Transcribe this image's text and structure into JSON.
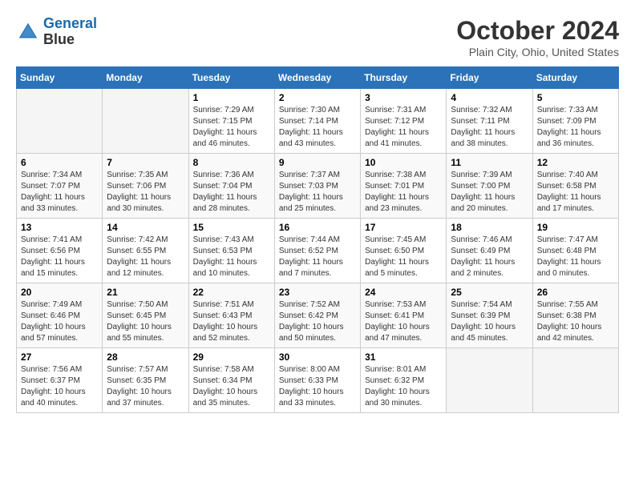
{
  "logo": {
    "line1": "General",
    "line2": "Blue"
  },
  "header": {
    "month": "October 2024",
    "location": "Plain City, Ohio, United States"
  },
  "weekdays": [
    "Sunday",
    "Monday",
    "Tuesday",
    "Wednesday",
    "Thursday",
    "Friday",
    "Saturday"
  ],
  "weeks": [
    [
      {
        "day": "",
        "sunrise": "",
        "sunset": "",
        "daylight": ""
      },
      {
        "day": "",
        "sunrise": "",
        "sunset": "",
        "daylight": ""
      },
      {
        "day": "1",
        "sunrise": "Sunrise: 7:29 AM",
        "sunset": "Sunset: 7:15 PM",
        "daylight": "Daylight: 11 hours and 46 minutes."
      },
      {
        "day": "2",
        "sunrise": "Sunrise: 7:30 AM",
        "sunset": "Sunset: 7:14 PM",
        "daylight": "Daylight: 11 hours and 43 minutes."
      },
      {
        "day": "3",
        "sunrise": "Sunrise: 7:31 AM",
        "sunset": "Sunset: 7:12 PM",
        "daylight": "Daylight: 11 hours and 41 minutes."
      },
      {
        "day": "4",
        "sunrise": "Sunrise: 7:32 AM",
        "sunset": "Sunset: 7:11 PM",
        "daylight": "Daylight: 11 hours and 38 minutes."
      },
      {
        "day": "5",
        "sunrise": "Sunrise: 7:33 AM",
        "sunset": "Sunset: 7:09 PM",
        "daylight": "Daylight: 11 hours and 36 minutes."
      }
    ],
    [
      {
        "day": "6",
        "sunrise": "Sunrise: 7:34 AM",
        "sunset": "Sunset: 7:07 PM",
        "daylight": "Daylight: 11 hours and 33 minutes."
      },
      {
        "day": "7",
        "sunrise": "Sunrise: 7:35 AM",
        "sunset": "Sunset: 7:06 PM",
        "daylight": "Daylight: 11 hours and 30 minutes."
      },
      {
        "day": "8",
        "sunrise": "Sunrise: 7:36 AM",
        "sunset": "Sunset: 7:04 PM",
        "daylight": "Daylight: 11 hours and 28 minutes."
      },
      {
        "day": "9",
        "sunrise": "Sunrise: 7:37 AM",
        "sunset": "Sunset: 7:03 PM",
        "daylight": "Daylight: 11 hours and 25 minutes."
      },
      {
        "day": "10",
        "sunrise": "Sunrise: 7:38 AM",
        "sunset": "Sunset: 7:01 PM",
        "daylight": "Daylight: 11 hours and 23 minutes."
      },
      {
        "day": "11",
        "sunrise": "Sunrise: 7:39 AM",
        "sunset": "Sunset: 7:00 PM",
        "daylight": "Daylight: 11 hours and 20 minutes."
      },
      {
        "day": "12",
        "sunrise": "Sunrise: 7:40 AM",
        "sunset": "Sunset: 6:58 PM",
        "daylight": "Daylight: 11 hours and 17 minutes."
      }
    ],
    [
      {
        "day": "13",
        "sunrise": "Sunrise: 7:41 AM",
        "sunset": "Sunset: 6:56 PM",
        "daylight": "Daylight: 11 hours and 15 minutes."
      },
      {
        "day": "14",
        "sunrise": "Sunrise: 7:42 AM",
        "sunset": "Sunset: 6:55 PM",
        "daylight": "Daylight: 11 hours and 12 minutes."
      },
      {
        "day": "15",
        "sunrise": "Sunrise: 7:43 AM",
        "sunset": "Sunset: 6:53 PM",
        "daylight": "Daylight: 11 hours and 10 minutes."
      },
      {
        "day": "16",
        "sunrise": "Sunrise: 7:44 AM",
        "sunset": "Sunset: 6:52 PM",
        "daylight": "Daylight: 11 hours and 7 minutes."
      },
      {
        "day": "17",
        "sunrise": "Sunrise: 7:45 AM",
        "sunset": "Sunset: 6:50 PM",
        "daylight": "Daylight: 11 hours and 5 minutes."
      },
      {
        "day": "18",
        "sunrise": "Sunrise: 7:46 AM",
        "sunset": "Sunset: 6:49 PM",
        "daylight": "Daylight: 11 hours and 2 minutes."
      },
      {
        "day": "19",
        "sunrise": "Sunrise: 7:47 AM",
        "sunset": "Sunset: 6:48 PM",
        "daylight": "Daylight: 11 hours and 0 minutes."
      }
    ],
    [
      {
        "day": "20",
        "sunrise": "Sunrise: 7:49 AM",
        "sunset": "Sunset: 6:46 PM",
        "daylight": "Daylight: 10 hours and 57 minutes."
      },
      {
        "day": "21",
        "sunrise": "Sunrise: 7:50 AM",
        "sunset": "Sunset: 6:45 PM",
        "daylight": "Daylight: 10 hours and 55 minutes."
      },
      {
        "day": "22",
        "sunrise": "Sunrise: 7:51 AM",
        "sunset": "Sunset: 6:43 PM",
        "daylight": "Daylight: 10 hours and 52 minutes."
      },
      {
        "day": "23",
        "sunrise": "Sunrise: 7:52 AM",
        "sunset": "Sunset: 6:42 PM",
        "daylight": "Daylight: 10 hours and 50 minutes."
      },
      {
        "day": "24",
        "sunrise": "Sunrise: 7:53 AM",
        "sunset": "Sunset: 6:41 PM",
        "daylight": "Daylight: 10 hours and 47 minutes."
      },
      {
        "day": "25",
        "sunrise": "Sunrise: 7:54 AM",
        "sunset": "Sunset: 6:39 PM",
        "daylight": "Daylight: 10 hours and 45 minutes."
      },
      {
        "day": "26",
        "sunrise": "Sunrise: 7:55 AM",
        "sunset": "Sunset: 6:38 PM",
        "daylight": "Daylight: 10 hours and 42 minutes."
      }
    ],
    [
      {
        "day": "27",
        "sunrise": "Sunrise: 7:56 AM",
        "sunset": "Sunset: 6:37 PM",
        "daylight": "Daylight: 10 hours and 40 minutes."
      },
      {
        "day": "28",
        "sunrise": "Sunrise: 7:57 AM",
        "sunset": "Sunset: 6:35 PM",
        "daylight": "Daylight: 10 hours and 37 minutes."
      },
      {
        "day": "29",
        "sunrise": "Sunrise: 7:58 AM",
        "sunset": "Sunset: 6:34 PM",
        "daylight": "Daylight: 10 hours and 35 minutes."
      },
      {
        "day": "30",
        "sunrise": "Sunrise: 8:00 AM",
        "sunset": "Sunset: 6:33 PM",
        "daylight": "Daylight: 10 hours and 33 minutes."
      },
      {
        "day": "31",
        "sunrise": "Sunrise: 8:01 AM",
        "sunset": "Sunset: 6:32 PM",
        "daylight": "Daylight: 10 hours and 30 minutes."
      },
      {
        "day": "",
        "sunrise": "",
        "sunset": "",
        "daylight": ""
      },
      {
        "day": "",
        "sunrise": "",
        "sunset": "",
        "daylight": ""
      }
    ]
  ]
}
